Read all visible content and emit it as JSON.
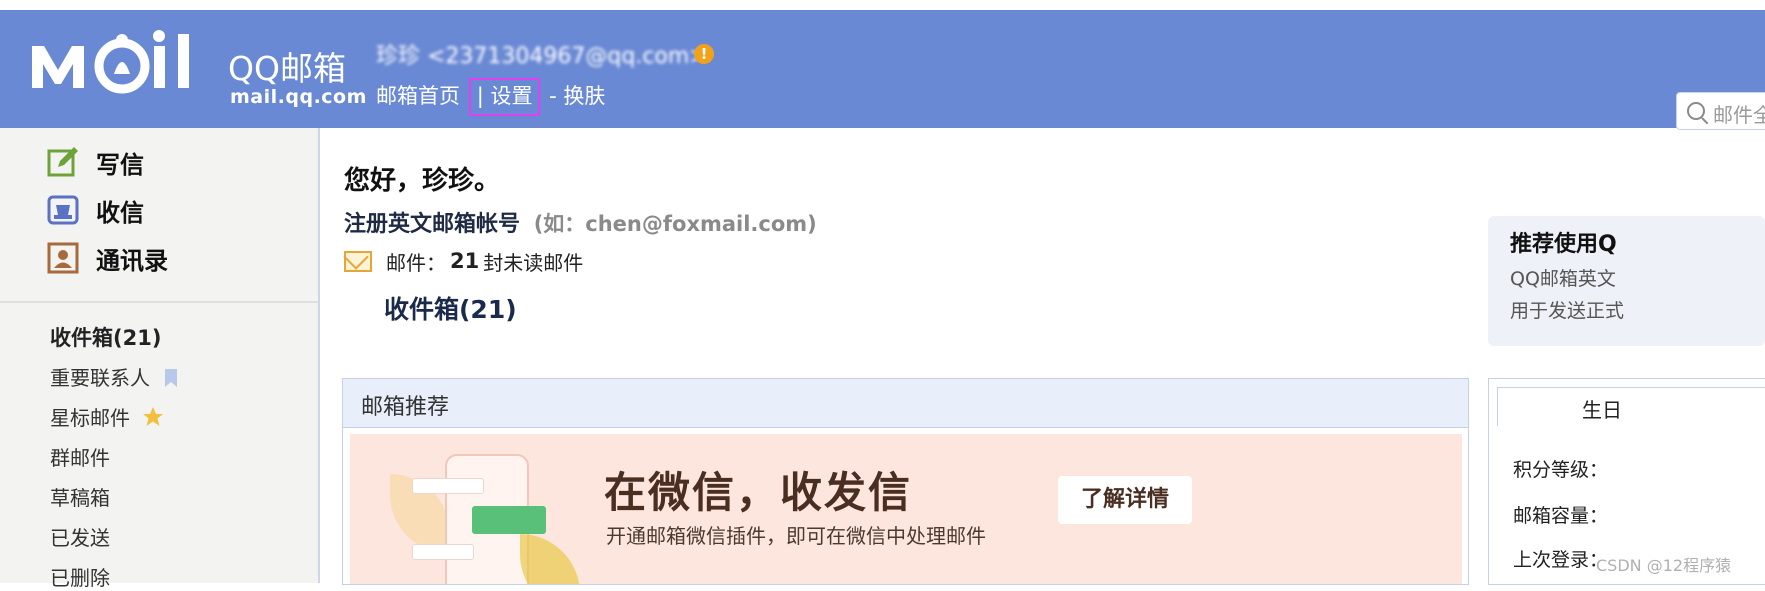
{
  "header": {
    "logo_text": "Mail",
    "brand": "QQ邮箱",
    "domain": "mail.qq.com",
    "account_display": "珍珍 <2371304967@qq.com>",
    "account_arrow": ">",
    "warning_glyph": "!",
    "nav": {
      "home": "邮箱首页",
      "sep1": "|",
      "settings": "设置",
      "sep2": "-",
      "skin": "换肤"
    },
    "search_placeholder": "邮件全文搜索"
  },
  "sidebar": {
    "actions": [
      {
        "label": "写信",
        "icon": "compose-icon"
      },
      {
        "label": "收信",
        "icon": "inbox-tray-icon"
      },
      {
        "label": "通讯录",
        "icon": "contacts-icon"
      }
    ],
    "folders": [
      {
        "label": "收件箱(21)",
        "bold": true
      },
      {
        "label": "重要联系人",
        "icon": "bookmark-icon"
      },
      {
        "label": "星标邮件",
        "icon": "star-icon"
      },
      {
        "label": "群邮件"
      },
      {
        "label": "草稿箱"
      },
      {
        "label": "已发送"
      },
      {
        "label": "已删除"
      }
    ]
  },
  "main": {
    "greeting": "您好，珍珍。",
    "register_title": "注册英文邮箱帐号",
    "register_example": "(如：chen@foxmail.com)",
    "mail_prefix": "邮件：",
    "unread_count": "21",
    "mail_suffix": "封未读邮件",
    "inbox_link": "收件箱(21)",
    "recommend": {
      "title": "邮箱推荐",
      "banner_title": "在微信，收发信",
      "banner_sub": "开通邮箱微信插件，即可在微信中处理邮件",
      "banner_button": "了解详情"
    },
    "side_promo": {
      "title": "推荐使用Q",
      "line1": "QQ邮箱英文",
      "line2": "用于发送正式"
    },
    "birthday": {
      "tab": "生日",
      "rows": [
        "积分等级：",
        "邮箱容量：",
        "上次登录："
      ]
    }
  },
  "watermark": "CSDN @12程序猿",
  "colors": {
    "header_bg": "#6a89d5",
    "highlight_box": "#e040f0",
    "banner_bg": "#fde6dd"
  }
}
